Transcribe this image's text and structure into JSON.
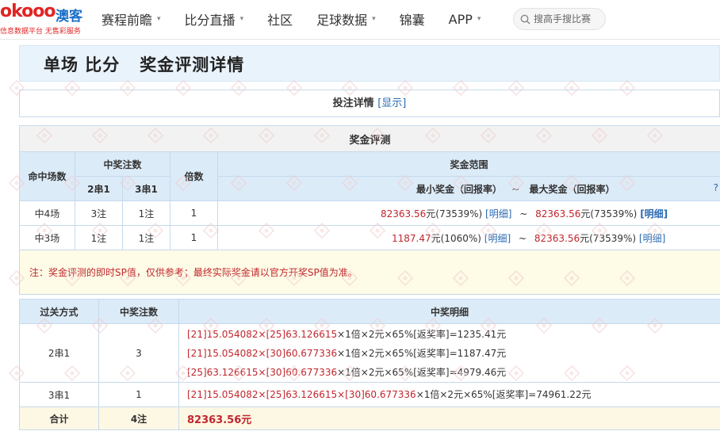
{
  "header": {
    "logo_mark": "okooo",
    "logo_brand": "澳客",
    "logo_tagline": "信息数据平台 无售彩服务",
    "nav": [
      {
        "label": "赛程前瞻",
        "dropdown": true
      },
      {
        "label": "比分直播",
        "dropdown": true
      },
      {
        "label": "社区",
        "dropdown": false
      },
      {
        "label": "足球数据",
        "dropdown": true
      },
      {
        "label": "锦囊",
        "dropdown": false
      },
      {
        "label": "APP",
        "dropdown": true
      }
    ],
    "search_placeholder": "搜高手搜比赛"
  },
  "page_title": "单场 比分   奖金评测详情",
  "bet_detail": {
    "label": "投注详情",
    "link": "[显示]"
  },
  "prize_eval": {
    "title": "奖金评测",
    "col_hits": "命中场数",
    "col_winning_bets": "中奖注数",
    "col_2c1": "2串1",
    "col_3c1": "3串1",
    "col_multiple": "倍数",
    "col_range": "奖金范围",
    "col_min": "最小奖金（回报率）",
    "range_sep": "~",
    "col_max": "最大奖金（回报率）",
    "help": "?",
    "rows": [
      {
        "hits": "中4场",
        "bets_2c1": "3注",
        "bets_3c1": "1注",
        "multiple": "1",
        "min_amount": "82363.56",
        "min_suffix": "元(73539%)",
        "min_link": "[明细]",
        "max_amount": "82363.56",
        "max_suffix": "元(73539%)",
        "max_link": "[明细]"
      },
      {
        "hits": "中3场",
        "bets_2c1": "1注",
        "bets_3c1": "1注",
        "multiple": "1",
        "min_amount": "1187.47",
        "min_suffix": "元(1060%)",
        "min_link": "[明细]",
        "max_amount": "82363.56",
        "max_suffix": "元(73539%)",
        "max_link": "[明细]"
      }
    ],
    "note": "注：奖金评测的即时SP值，仅供参考；最终实际奖金请以官方开奖SP值为准。"
  },
  "detail": {
    "col_type": "过关方式",
    "col_count": "中奖注数",
    "col_detail": "中奖明细",
    "groups": [
      {
        "type": "2串1",
        "count": "3",
        "lines": [
          {
            "red": "[21]15.054082×[25]63.126615",
            "rest": "×1倍×2元×65%[返奖率]=1235.41元"
          },
          {
            "red": "[21]15.054082×[30]60.677336",
            "rest": "×1倍×2元×65%[返奖率]=1187.47元"
          },
          {
            "red": "[25]63.126615×[30]60.677336",
            "rest": "×1倍×2元×65%[返奖率]=4979.46元"
          }
        ]
      },
      {
        "type": "3串1",
        "count": "1",
        "lines": [
          {
            "red": "[21]15.054082×[25]63.126615×[30]60.677336",
            "rest": "×1倍×2元×65%[返奖率]=74961.22元"
          }
        ]
      }
    ],
    "total_label": "合计",
    "total_count": "4注",
    "total_amount": "82363.56元"
  },
  "colors": {
    "accent_blue": "#2a6bb3",
    "accent_red": "#c0262d",
    "header_blue": "#dcebf8",
    "note_bg": "#fefbe6"
  },
  "icons": {
    "search": "search-icon",
    "watermark": "watermark-icon"
  }
}
